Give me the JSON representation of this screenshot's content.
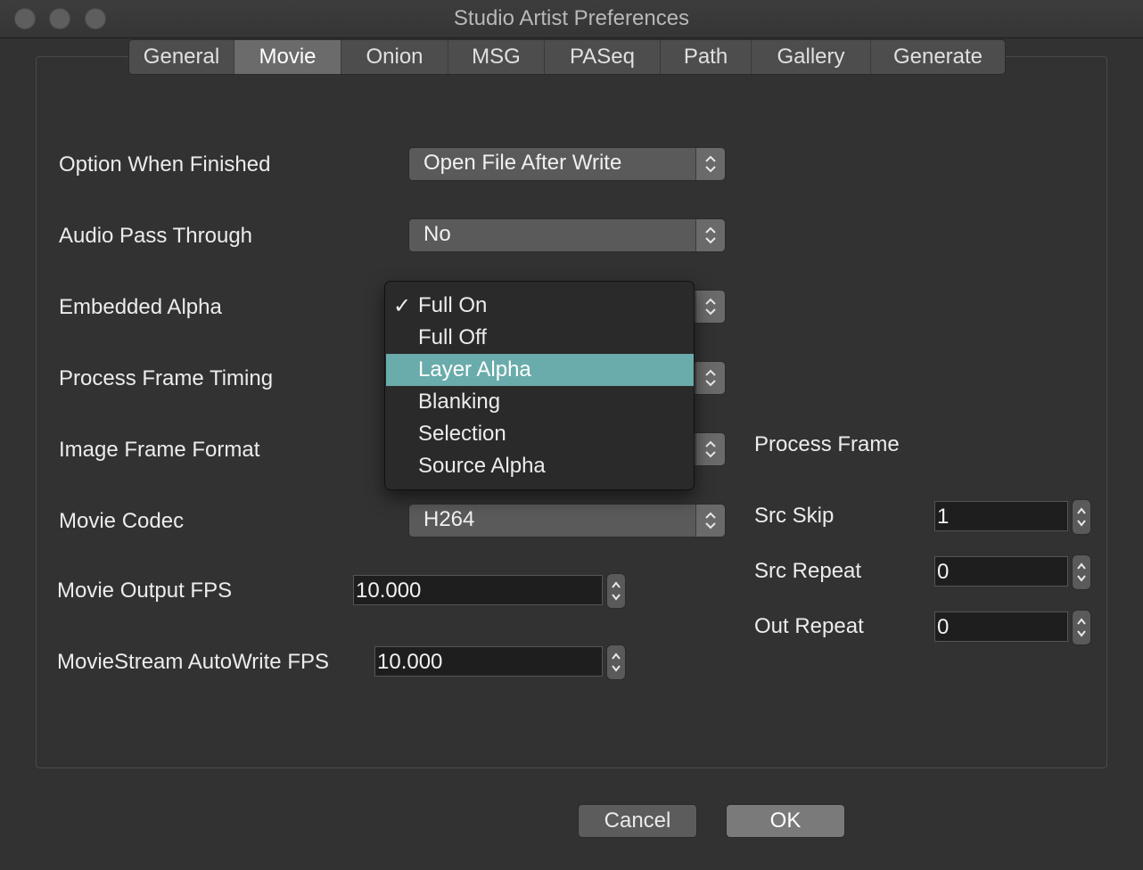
{
  "window": {
    "title": "Studio Artist Preferences"
  },
  "tabs": [
    {
      "label": "General"
    },
    {
      "label": "Movie"
    },
    {
      "label": "Onion"
    },
    {
      "label": "MSG"
    },
    {
      "label": "PASeq"
    },
    {
      "label": "Path"
    },
    {
      "label": "Gallery"
    },
    {
      "label": "Generate"
    }
  ],
  "active_tab": "Movie",
  "settings": {
    "option_when_finished": {
      "label": "Option When Finished",
      "value": "Open File After Write"
    },
    "audio_pass_through": {
      "label": "Audio Pass Through",
      "value": "No"
    },
    "embedded_alpha": {
      "label": "Embedded Alpha",
      "value": "Full On"
    },
    "process_frame_timing": {
      "label": "Process Frame Timing"
    },
    "image_frame_format": {
      "label": "Image Frame Format"
    },
    "movie_codec": {
      "label": "Movie Codec",
      "value": "H264"
    },
    "movie_output_fps": {
      "label": "Movie Output FPS",
      "value": "10.000"
    },
    "moviestream_autowrite_fps": {
      "label": "MovieStream AutoWrite FPS",
      "value": "10.000"
    }
  },
  "process_frame": {
    "heading": "Process Frame",
    "src_skip": {
      "label": "Src Skip",
      "value": "1"
    },
    "src_repeat": {
      "label": "Src Repeat",
      "value": "0"
    },
    "out_repeat": {
      "label": "Out Repeat",
      "value": "0"
    }
  },
  "embedded_alpha_menu": {
    "items": [
      "Full On",
      "Full Off",
      "Layer Alpha",
      "Blanking",
      "Selection",
      "Source Alpha"
    ],
    "checked": "Full On",
    "highlighted": "Layer Alpha",
    "check_glyph": "✓"
  },
  "buttons": {
    "cancel": "Cancel",
    "ok": "OK"
  },
  "colors": {
    "highlight": "#6aabab",
    "window_bg": "#323232"
  }
}
